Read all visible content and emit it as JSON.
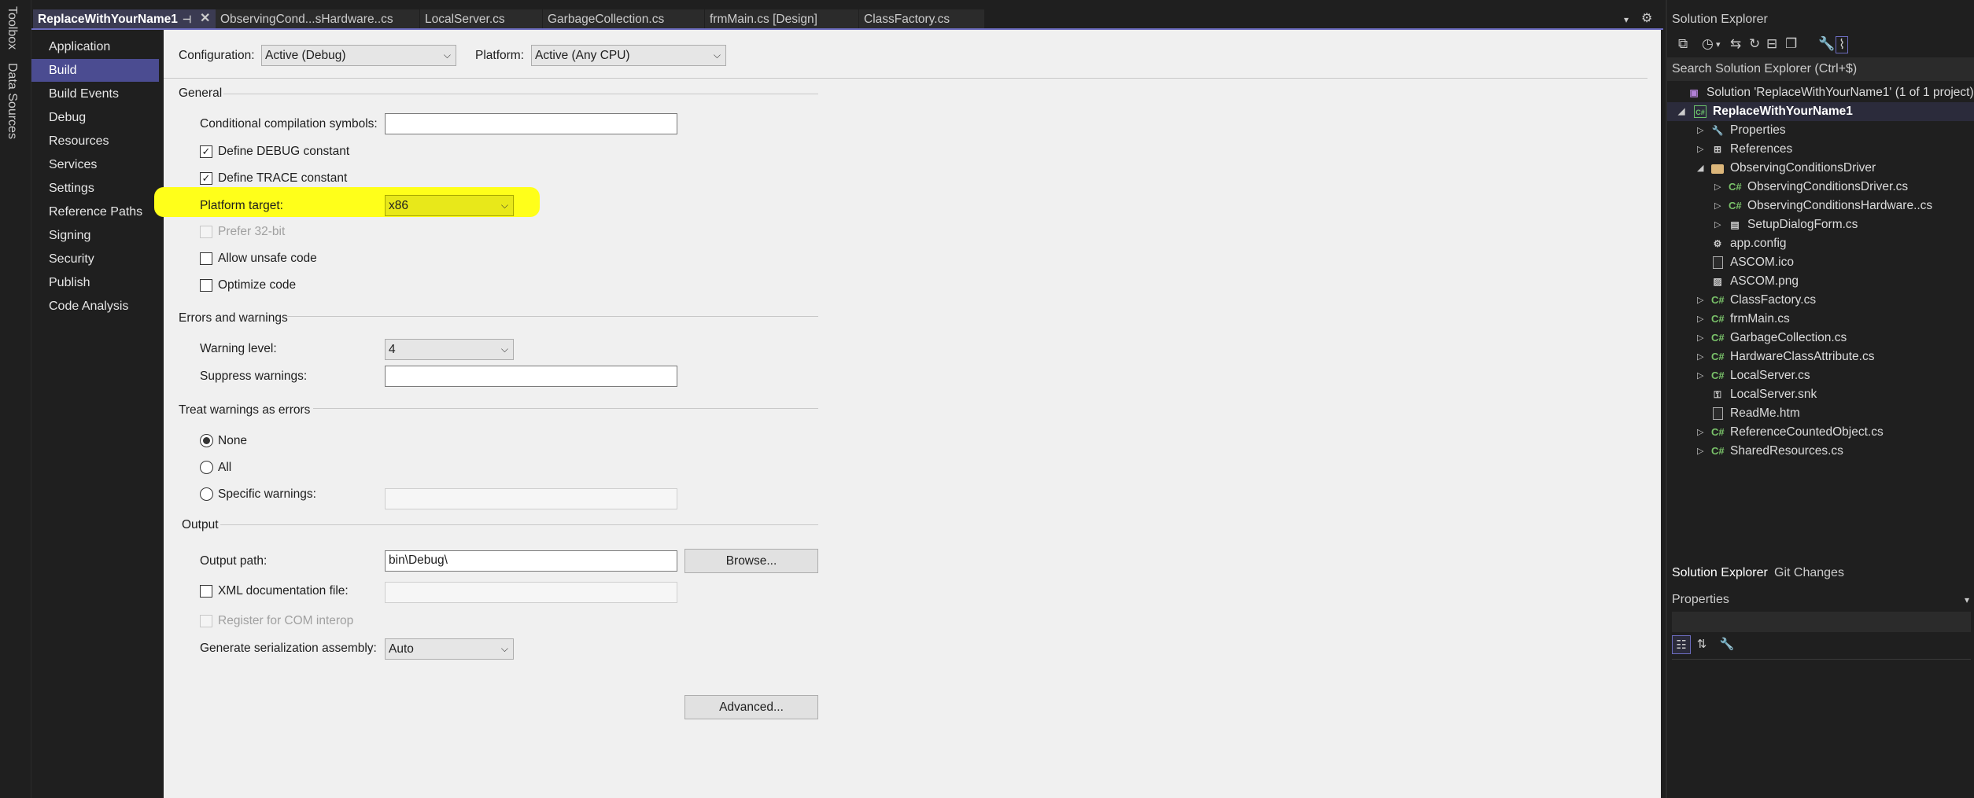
{
  "left_strip": {
    "toolbox": "Toolbox",
    "data_sources": "Data Sources"
  },
  "tabs": [
    {
      "label": "ReplaceWithYourName1",
      "active": true
    },
    {
      "label": "ObservingCond...sHardware..cs"
    },
    {
      "label": "LocalServer.cs"
    },
    {
      "label": "GarbageCollection.cs"
    },
    {
      "label": "frmMain.cs [Design]"
    },
    {
      "label": "ClassFactory.cs"
    }
  ],
  "nav": {
    "items": [
      "Application",
      "Build",
      "Build Events",
      "Debug",
      "Resources",
      "Services",
      "Settings",
      "Reference Paths",
      "Signing",
      "Security",
      "Publish",
      "Code Analysis"
    ],
    "selected": "Build"
  },
  "header": {
    "configuration_label": "Configuration:",
    "configuration_value": "Active (Debug)",
    "platform_label": "Platform:",
    "platform_value": "Active (Any CPU)"
  },
  "general": {
    "title": "General",
    "conditional_label": "Conditional compilation symbols:",
    "conditional_value": "",
    "define_debug": {
      "label": "Define DEBUG constant",
      "checked": true
    },
    "define_trace": {
      "label": "Define TRACE constant",
      "checked": true
    },
    "platform_target_label": "Platform target:",
    "platform_target_value": "x86",
    "prefer32": {
      "label": "Prefer 32-bit",
      "checked": false,
      "enabled": false
    },
    "allow_unsafe": {
      "label": "Allow unsafe code",
      "checked": false
    },
    "optimize": {
      "label": "Optimize code",
      "checked": false
    }
  },
  "errors": {
    "title": "Errors and warnings",
    "warning_level_label": "Warning level:",
    "warning_level_value": "4",
    "suppress_label": "Suppress warnings:",
    "suppress_value": ""
  },
  "treat": {
    "title": "Treat warnings as errors",
    "options": [
      "None",
      "All",
      "Specific warnings:"
    ],
    "selected": "None"
  },
  "output": {
    "title": "Output",
    "path_label": "Output path:",
    "path_value": "bin\\Debug\\",
    "browse_label": "Browse...",
    "xml_label": "XML documentation file:",
    "com_label": "Register for COM interop",
    "serialization_label": "Generate serialization assembly:",
    "serialization_value": "Auto",
    "advanced_label": "Advanced..."
  },
  "solution_explorer": {
    "title": "Solution Explorer",
    "search_placeholder": "Search Solution Explorer (Ctrl+$)",
    "solution": "Solution 'ReplaceWithYourName1' (1 of 1 project)",
    "project": "ReplaceWithYourName1",
    "items": {
      "properties": "Properties",
      "references": "References",
      "observing_folder": "ObservingConditionsDriver",
      "ocd": "ObservingConditionsDriver.cs",
      "och": "ObservingConditionsHardware..cs",
      "setup": "SetupDialogForm.cs",
      "appconfig": "app.config",
      "ascom_ico": "ASCOM.ico",
      "ascom_png": "ASCOM.png",
      "classfactory": "ClassFactory.cs",
      "frmmain": "frmMain.cs",
      "garbage": "GarbageCollection.cs",
      "hwattr": "HardwareClassAttribute.cs",
      "localserver": "LocalServer.cs",
      "localserver_snk": "LocalServer.snk",
      "readme": "ReadMe.htm",
      "refcounted": "ReferenceCountedObject.cs",
      "shared": "SharedResources.cs"
    },
    "bottom_tabs": [
      "Solution Explorer",
      "Git Changes"
    ],
    "properties_title": "Properties"
  },
  "colors": {
    "accent": "#4b4c91",
    "highlight": "#ffff1a",
    "cs_green": "#7ac36a"
  }
}
